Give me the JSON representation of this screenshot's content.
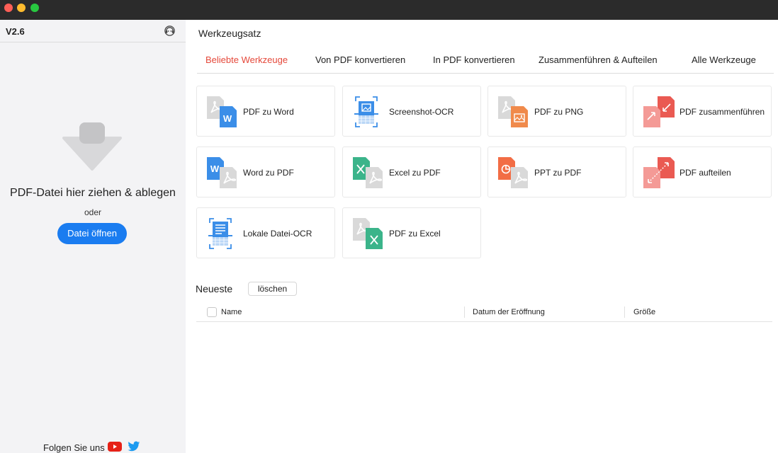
{
  "sidebar": {
    "version": "V2.6",
    "drop_text": "PDF-Datei hier ziehen & ablegen",
    "or_text": "oder",
    "open_button": "Datei öffnen",
    "follow_text": "Folgen Sie uns"
  },
  "main": {
    "title": "Werkzeugsatz",
    "tabs": [
      {
        "label": "Beliebte Werkzeuge",
        "active": true
      },
      {
        "label": "Von PDF konvertieren",
        "active": false
      },
      {
        "label": "In PDF konvertieren",
        "active": false
      },
      {
        "label": "Zusammenführen & Aufteilen",
        "active": false
      },
      {
        "label": "Alle Werkzeuge",
        "active": false
      }
    ],
    "tools": [
      {
        "label": "PDF zu Word",
        "icon": "pdf-to-word-icon"
      },
      {
        "label": "Screenshot-OCR",
        "icon": "screenshot-ocr-icon"
      },
      {
        "label": "PDF zu PNG",
        "icon": "pdf-to-png-icon"
      },
      {
        "label": "PDF zusammenführen",
        "icon": "pdf-merge-icon"
      },
      {
        "label": "Word zu PDF",
        "icon": "word-to-pdf-icon"
      },
      {
        "label": "Excel zu PDF",
        "icon": "excel-to-pdf-icon"
      },
      {
        "label": "PPT zu PDF",
        "icon": "ppt-to-pdf-icon"
      },
      {
        "label": "PDF aufteilen",
        "icon": "pdf-split-icon"
      },
      {
        "label": "Lokale Datei-OCR",
        "icon": "local-file-ocr-icon"
      },
      {
        "label": "PDF zu Excel",
        "icon": "pdf-to-excel-icon"
      }
    ],
    "recent": {
      "title": "Neueste",
      "clear_button": "löschen",
      "columns": [
        "Name",
        "Datum der Eröffnung",
        "Größe"
      ]
    }
  },
  "colors": {
    "accent_blue": "#1a7cf0",
    "active_tab_red": "#e5483a",
    "word_blue": "#3b8ee8",
    "png_orange": "#f08a4b",
    "pdf_red": "#ea5a52",
    "excel_green": "#3bb48a",
    "ppt_orange": "#f26d45"
  }
}
